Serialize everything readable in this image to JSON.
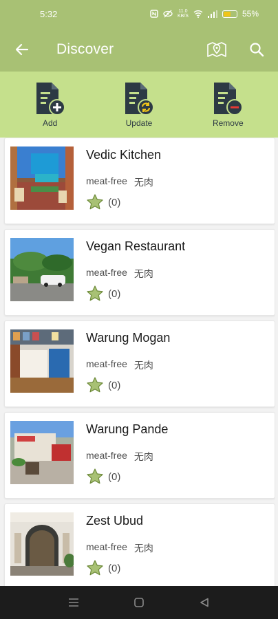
{
  "status_bar": {
    "time": "5:32",
    "network_speed_top": "11.0",
    "network_speed_bottom": "KB/S",
    "battery_percent": "55%",
    "battery_level": 0.55
  },
  "app_bar": {
    "title": "Discover",
    "back_icon": "arrow-left-icon",
    "map_icon": "map-pin-icon",
    "search_icon": "search-icon"
  },
  "actions": [
    {
      "label": "Add",
      "icon": "document-add-icon"
    },
    {
      "label": "Update",
      "icon": "document-update-icon"
    },
    {
      "label": "Remove",
      "icon": "document-remove-icon"
    }
  ],
  "restaurants": [
    {
      "name": "Vedic Kitchen",
      "tag_en": "meat-free",
      "tag_zh": "无肉",
      "rating": "(0)"
    },
    {
      "name": "Vegan Restaurant",
      "tag_en": "meat-free",
      "tag_zh": "无肉",
      "rating": "(0)"
    },
    {
      "name": "Warung Mogan",
      "tag_en": "meat-free",
      "tag_zh": "无肉",
      "rating": "(0)"
    },
    {
      "name": "Warung Pande",
      "tag_en": "meat-free",
      "tag_zh": "无肉",
      "rating": "(0)"
    },
    {
      "name": "Zest Ubud",
      "tag_en": "meat-free",
      "tag_zh": "无肉",
      "rating": "(0)"
    }
  ],
  "colors": {
    "app_bar": "#a8c174",
    "action_strip": "#c5e08c",
    "icon_dark": "#2d3a44",
    "star": "#a8c174"
  }
}
